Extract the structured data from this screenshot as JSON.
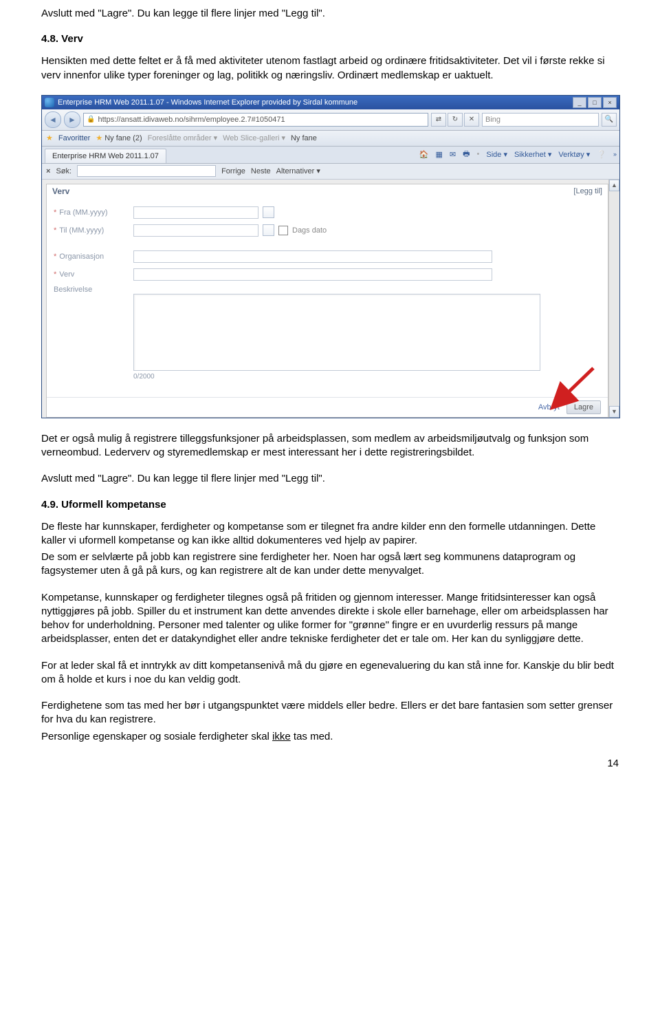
{
  "doc": {
    "intro_line": "Avslutt med \"Lagre\". Du kan legge til flere linjer med \"Legg til\".",
    "s48_heading": "4.8. Verv",
    "s48_p1": "Hensikten med dette feltet er å få med aktiviteter utenom fastlagt arbeid og ordinære fritidsaktiviteter. Det vil i første rekke si verv innenfor ulike typer foreninger og lag, politikk og næringsliv.  Ordinært medlemskap er uaktuelt.",
    "after_shot_p1": "Det er også mulig å registrere tilleggsfunksjoner på arbeidsplassen, som medlem av arbeidsmiljøutvalg og funksjon som verneombud.  Lederverv og styremedlemskap er mest interessant her i dette registreringsbildet.",
    "after_shot_p2": "Avslutt med \"Lagre\". Du kan legge til flere linjer med \"Legg til\".",
    "s49_heading": "4.9. Uformell kompetanse",
    "s49_p1": "De fleste har kunnskaper, ferdigheter og kompetanse som er tilegnet fra andre kilder enn den formelle utdanningen.  Dette kaller vi uformell kompetanse og kan ikke alltid dokumenteres ved hjelp av papirer.",
    "s49_p2": "De som er selvlærte på jobb kan registrere sine ferdigheter her.  Noen har også lært seg kommunens dataprogram og fagsystemer uten å gå på kurs, og kan registrere alt de kan under dette menyvalget.",
    "s49_p3": "Kompetanse, kunnskaper og ferdigheter tilegnes også på fritiden og gjennom interesser.  Mange fritidsinteresser kan også nyttiggjøres på jobb. Spiller du et instrument kan dette anvendes direkte i skole eller barnehage, eller om arbeidsplassen har behov for underholdning.   Personer med talenter og ulike former for \"grønne\" fingre er en uvurderlig ressurs på mange arbeidsplasser, enten det er datakyndighet eller andre tekniske ferdigheter det er tale om.   Her kan du synliggjøre dette.",
    "s49_p4": "For at leder skal få et inntrykk av ditt kompetansenivå må du gjøre en egenevaluering du kan stå inne for. Kanskje du blir bedt om å holde et kurs i noe du kan veldig godt.",
    "s49_p5a": "Ferdighetene som tas med her bør i utgangspunktet være middels eller bedre.  Ellers er det bare fantasien som setter grenser for hva du kan registrere.",
    "s49_p5b_pre": "Personlige egenskaper og sosiale ferdigheter skal ",
    "s49_p5b_u": "ikke",
    "s49_p5b_post": " tas med.",
    "page_number": "14"
  },
  "ie": {
    "title": "Enterprise HRM Web 2011.1.07 - Windows Internet Explorer provided by Sirdal kommune",
    "url": "https://ansatt.idivaweb.no/sihrm/employee.2.7#1050471",
    "search_placeholder": "Bing",
    "fav_label": "Favoritter",
    "fav_items": [
      "Ny fane (2)",
      "Foreslåtte områder",
      "Web Slice-galleri",
      "Ny fane"
    ],
    "tab_label": "Enterprise HRM Web 2011.1.07",
    "page_tools": [
      "Side",
      "Sikkerhet",
      "Verktøy"
    ],
    "find_label": "Søk:",
    "find_prev": "Forrige",
    "find_next": "Neste",
    "find_alt": "Alternativer"
  },
  "form": {
    "panel_title": "Verv",
    "legg_til": "[Legg til]",
    "fields": {
      "fra": "Fra (MM.yyyy)",
      "til": "Til (MM.yyyy)",
      "dags_dato": "Dags dato",
      "organisasjon": "Organisasjon",
      "verv": "Verv",
      "beskrivelse": "Beskrivelse"
    },
    "charcount": "0/2000",
    "avbryt": "Avbryt",
    "lagre": "Lagre"
  }
}
